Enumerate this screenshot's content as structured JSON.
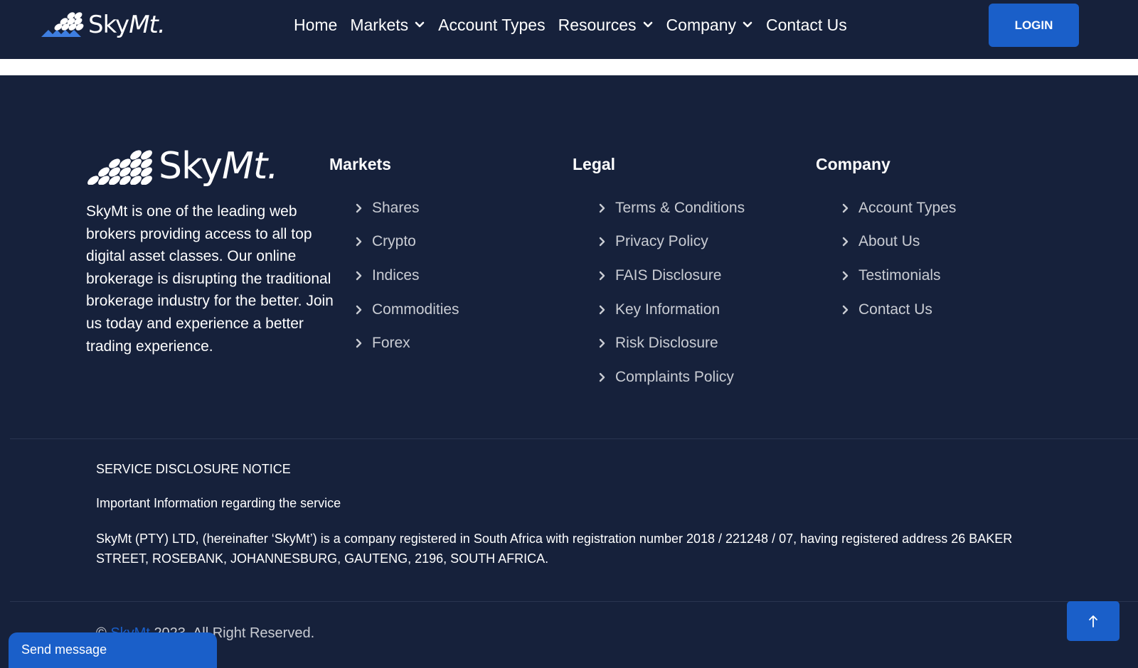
{
  "brand": {
    "name_part1": "Sky",
    "name_part2": "Mt."
  },
  "header": {
    "nav": [
      {
        "label": "Home",
        "has_dropdown": false
      },
      {
        "label": "Markets",
        "has_dropdown": true
      },
      {
        "label": "Account Types",
        "has_dropdown": false
      },
      {
        "label": "Resources",
        "has_dropdown": true
      },
      {
        "label": "Company",
        "has_dropdown": true
      },
      {
        "label": "Contact Us",
        "has_dropdown": false
      }
    ],
    "login_label": "LOGIN"
  },
  "footer": {
    "about": "SkyMt is one of the leading web brokers providing access to all top digital asset classes. Our online brokerage is disrupting the traditional brokerage industry for the better. Join us today and experience a better trading experience.",
    "markets": {
      "title": "Markets",
      "items": [
        "Shares",
        "Crypto",
        "Indices",
        "Commodities",
        "Forex"
      ]
    },
    "legal": {
      "title": "Legal",
      "items": [
        "Terms & Conditions",
        "Privacy Policy",
        "FAIS Disclosure",
        "Key Information",
        "Risk Disclosure",
        "Complaints Policy"
      ]
    },
    "company": {
      "title": "Company",
      "items": [
        "Account Types",
        "About Us",
        "Testimonials",
        "Contact Us"
      ]
    }
  },
  "notice": {
    "title": "SERVICE DISCLOSURE NOTICE",
    "subtitle": "Important Information regarding the service",
    "body": "SkyMt (PTY) LTD, (hereinafter ‘SkyMt’) is a company registered in South Africa with registration number 2018 / 221248 / 07, having registered address 26 BAKER STREET, ROSEBANK, JOHANNESBURG, GAUTENG, 2196, SOUTH AFRICA."
  },
  "copyright": {
    "symbol": "©",
    "brand": "SkyMt",
    "text": "2023. All Right Reserved."
  },
  "chat": {
    "label": "Send message"
  },
  "icons": {
    "chevron": "chevron-down-icon",
    "arrow": "chevron-right-icon",
    "top": "arrow-up-icon"
  },
  "colors": {
    "background": "#16213b",
    "accent": "#1a5fc9",
    "link": "#c9ccd3"
  }
}
